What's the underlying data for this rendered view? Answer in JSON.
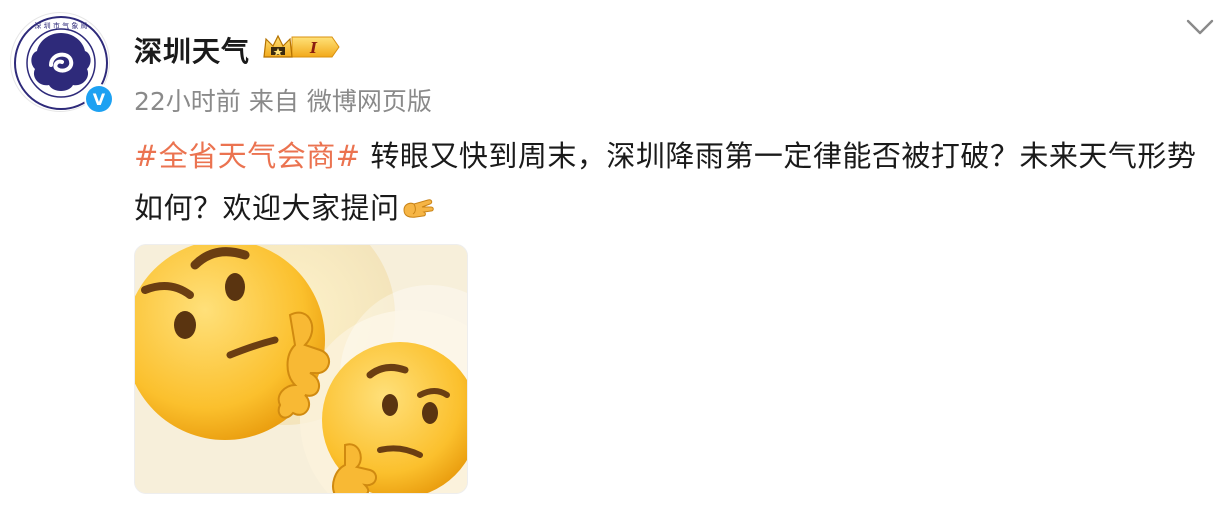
{
  "post": {
    "author": {
      "name": "深圳天气",
      "avatar_icon": "shenzhen-meteorology-seal-icon",
      "verified_icon": "verified-v-icon"
    },
    "time": "22小时前",
    "source_prefix": "来自",
    "source": "微博网页版",
    "hashtag": "#全省天气会商#",
    "text": " 转眼又快到周末，深圳降雨第一定律能否被打破？未来天气形势如何？欢迎大家提问",
    "emoji_icon": "hand-pointing-emoji-icon",
    "image_icon": "thinking-face-emoji-image",
    "accent_color": "#eb7350",
    "verified_color": "#1da1f2"
  }
}
